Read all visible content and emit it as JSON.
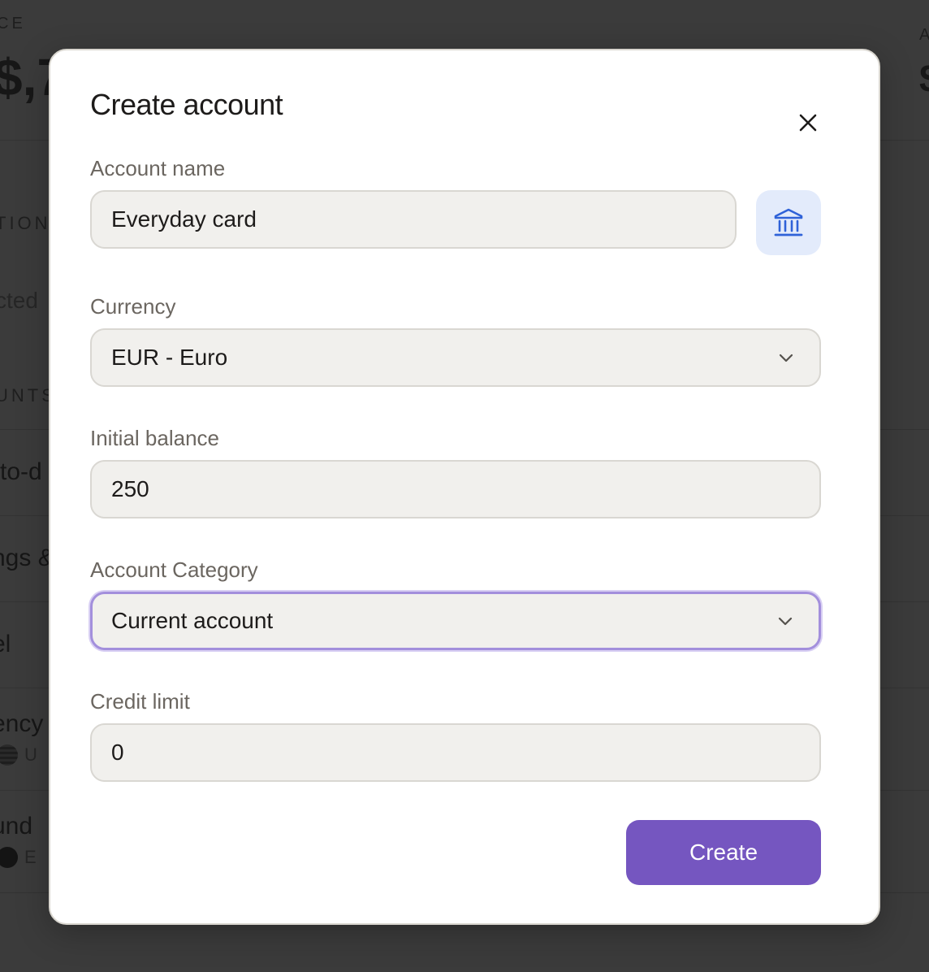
{
  "background": {
    "balance_label": "CE",
    "balance_amount": "$,7",
    "right_label": "A",
    "right_amount": "$",
    "section1_label": "TION",
    "section1_text": "cted",
    "section2_label": "UNTS",
    "rows": [
      {
        "title": "-to-d",
        "sub": ""
      },
      {
        "title": "ngs &",
        "sub": ""
      },
      {
        "title": "el",
        "sub": ""
      },
      {
        "title": "ency",
        "sub": "U",
        "flag": "us"
      },
      {
        "title": "und",
        "sub": "E",
        "flag": "eu"
      }
    ]
  },
  "modal": {
    "title": "Create account",
    "close_icon": "close-icon",
    "account_name": {
      "label": "Account name",
      "value": "Everyday card"
    },
    "bank_icon": "bank-icon",
    "currency": {
      "label": "Currency",
      "value": "EUR - Euro"
    },
    "initial_balance": {
      "label": "Initial balance",
      "value": "250"
    },
    "account_category": {
      "label": "Account Category",
      "value": "Current account"
    },
    "credit_limit": {
      "label": "Credit limit",
      "value": "0"
    },
    "create_label": "Create"
  },
  "colors": {
    "primary": "#7556c0",
    "focus_ring": "#a38fdc",
    "bank_icon": "#2f62d8",
    "bank_icon_bg": "#e3ebfb",
    "input_bg": "#f1f0ed",
    "overlay": "#3b3b3b"
  }
}
